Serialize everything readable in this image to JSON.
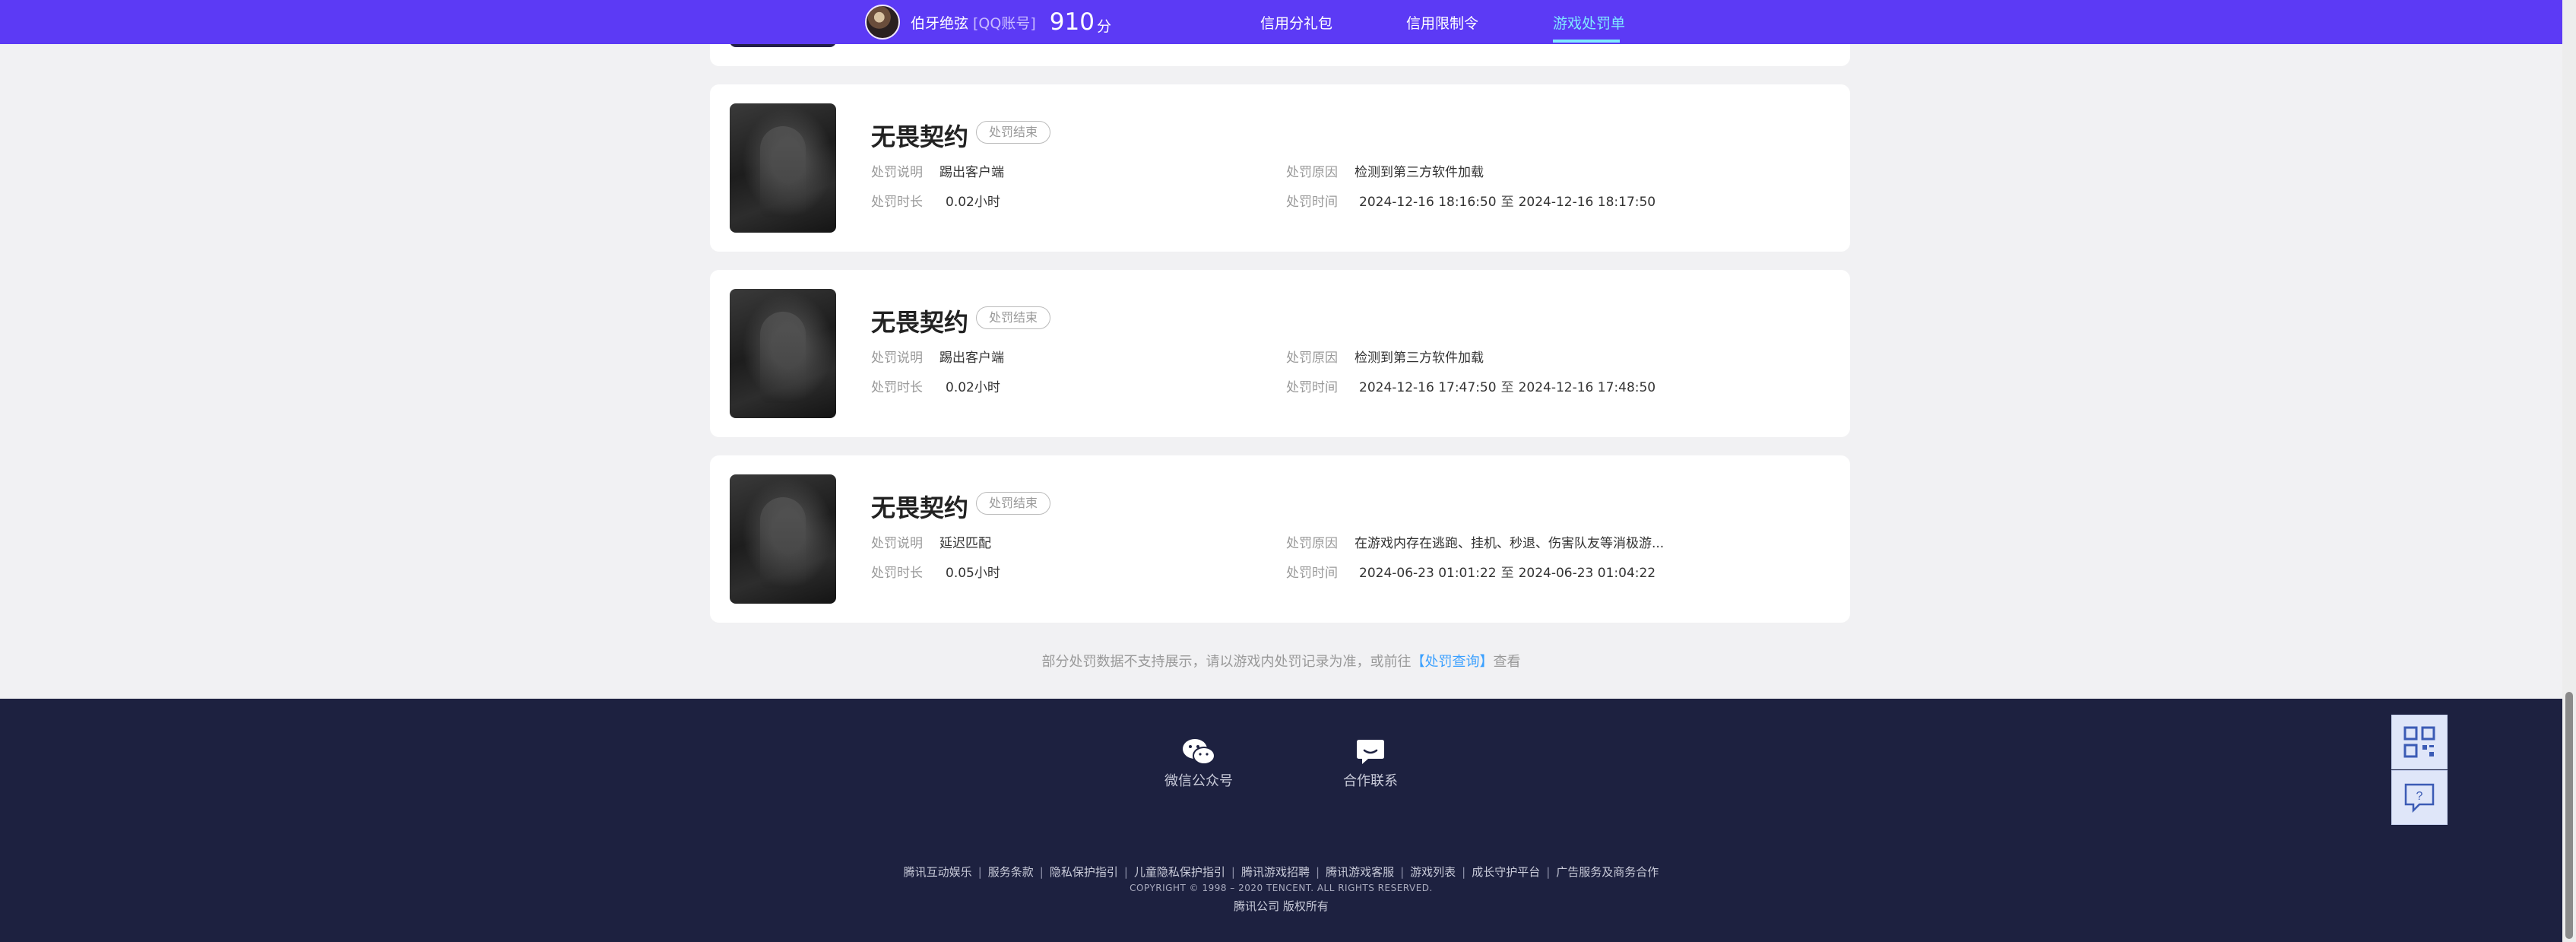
{
  "header": {
    "user": {
      "name": "伯牙绝弦",
      "account_tag": "[QQ账号]",
      "score": "910",
      "score_unit": "分"
    },
    "tabs": [
      {
        "label": "信用分礼包"
      },
      {
        "label": "信用限制令"
      },
      {
        "label": "游戏处罚单"
      }
    ],
    "active_tab": "游戏处罚单"
  },
  "labels": {
    "desc": "处罚说明",
    "reason": "处罚原因",
    "duration": "处罚时长",
    "time": "处罚时间",
    "time_sep": "至"
  },
  "records": [
    {
      "game": "无畏契约",
      "status": "处罚结束",
      "desc": "踢出客户端",
      "reason": "检测到第三方软件加载",
      "duration": "0.02小时",
      "time_start": "2024-12-16 18:16:50",
      "time_end": "2024-12-16 18:17:50"
    },
    {
      "game": "无畏契约",
      "status": "处罚结束",
      "desc": "踢出客户端",
      "reason": "检测到第三方软件加载",
      "duration": "0.02小时",
      "time_start": "2024-12-16 17:47:50",
      "time_end": "2024-12-16 17:48:50"
    },
    {
      "game": "无畏契约",
      "status": "处罚结束",
      "desc": "延迟匹配",
      "reason": "在游戏内存在逃跑、挂机、秒退、伤害队友等消极游...",
      "duration": "0.05小时",
      "time_start": "2024-06-23 01:01:22",
      "time_end": "2024-06-23 01:04:22"
    }
  ],
  "notice": {
    "text_before": "部分处罚数据不支持展示，请以游戏内处罚记录为准，或前往",
    "link": "【处罚查询】",
    "text_after": "查看"
  },
  "footer": {
    "icons": [
      {
        "label": "微信公众号",
        "icon": "wechat-icon"
      },
      {
        "label": "合作联系",
        "icon": "chat-bubble-icon"
      }
    ],
    "links": [
      "腾讯互动娱乐",
      "服务条款",
      "隐私保护指引",
      "儿童隐私保护指引",
      "腾讯游戏招聘",
      "腾讯游戏客服",
      "游戏列表",
      "成长守护平台",
      "广告服务及商务合作"
    ],
    "link_sep": "|",
    "copyright": "COPYRIGHT © 1998 – 2020 TENCENT. ALL RIGHTS RESERVED.",
    "rights": "腾讯公司 版权所有"
  },
  "side_buttons": [
    {
      "icon": "qr-code-icon"
    },
    {
      "icon": "feedback-icon"
    }
  ],
  "colors": {
    "header_bg": "#5c3af5",
    "active_tab": "#7fe8ff",
    "footer_bg": "#1d2140",
    "link": "#3aa0ff"
  }
}
